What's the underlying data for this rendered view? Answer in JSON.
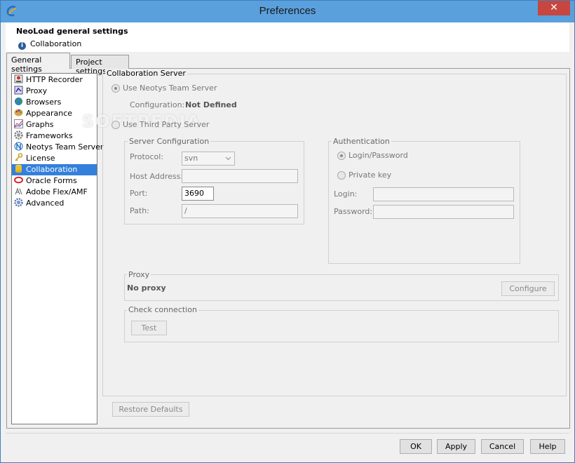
{
  "window": {
    "title": "Preferences",
    "close_glyph": "✕",
    "icon": "neoload-logo-icon",
    "accent": "#5aa0dc"
  },
  "header": {
    "title": "NeoLoad general settings",
    "subtitle": "Collaboration",
    "info_glyph": "i"
  },
  "tabs": [
    {
      "label": "General settings",
      "active": true
    },
    {
      "label": "Project settings",
      "active": false
    }
  ],
  "nav": {
    "items": [
      {
        "label": "HTTP Recorder",
        "icon": "recorder-icon"
      },
      {
        "label": "Proxy",
        "icon": "proxy-icon"
      },
      {
        "label": "Browsers",
        "icon": "globe-icon"
      },
      {
        "label": "Appearance",
        "icon": "palette-icon"
      },
      {
        "label": "Graphs",
        "icon": "graph-icon"
      },
      {
        "label": "Frameworks",
        "icon": "gear-icon"
      },
      {
        "label": "Neotys Team Server",
        "icon": "neotys-icon"
      },
      {
        "label": "License",
        "icon": "key-icon"
      },
      {
        "label": "Collaboration",
        "icon": "database-icon",
        "selected": true
      },
      {
        "label": "Oracle Forms",
        "icon": "oracle-icon"
      },
      {
        "label": "Adobe Flex/AMF",
        "icon": "flex-icon"
      },
      {
        "label": "Advanced",
        "icon": "gear-icon"
      }
    ],
    "selected_color": "#3380dc"
  },
  "collab": {
    "group_title": "Collaboration Server",
    "use_neotys": "Use Neotys Team Server",
    "configuration_label": "Configuration:",
    "configuration_value": "Not Defined",
    "use_third_party": "Use Third Party Server",
    "server_config": {
      "title": "Server Configuration",
      "protocol_label": "Protocol:",
      "protocol_value": "svn",
      "host_label": "Host Address:",
      "host_value": "",
      "port_label": "Port:",
      "port_value": "3690",
      "path_label": "Path:",
      "path_value": "/"
    },
    "auth": {
      "title": "Authentication",
      "login_password": "Login/Password",
      "private_key": "Private key",
      "login_label": "Login:",
      "login_value": "",
      "password_label": "Password:",
      "password_value": ""
    },
    "proxy": {
      "title": "Proxy",
      "value": "No proxy",
      "configure_button": "Configure"
    },
    "check": {
      "title": "Check connection",
      "test_button": "Test"
    }
  },
  "restore_defaults": "Restore Defaults",
  "watermark": "SOFTPEDIA",
  "buttons": {
    "ok": "OK",
    "apply": "Apply",
    "cancel": "Cancel",
    "help": "Help"
  }
}
